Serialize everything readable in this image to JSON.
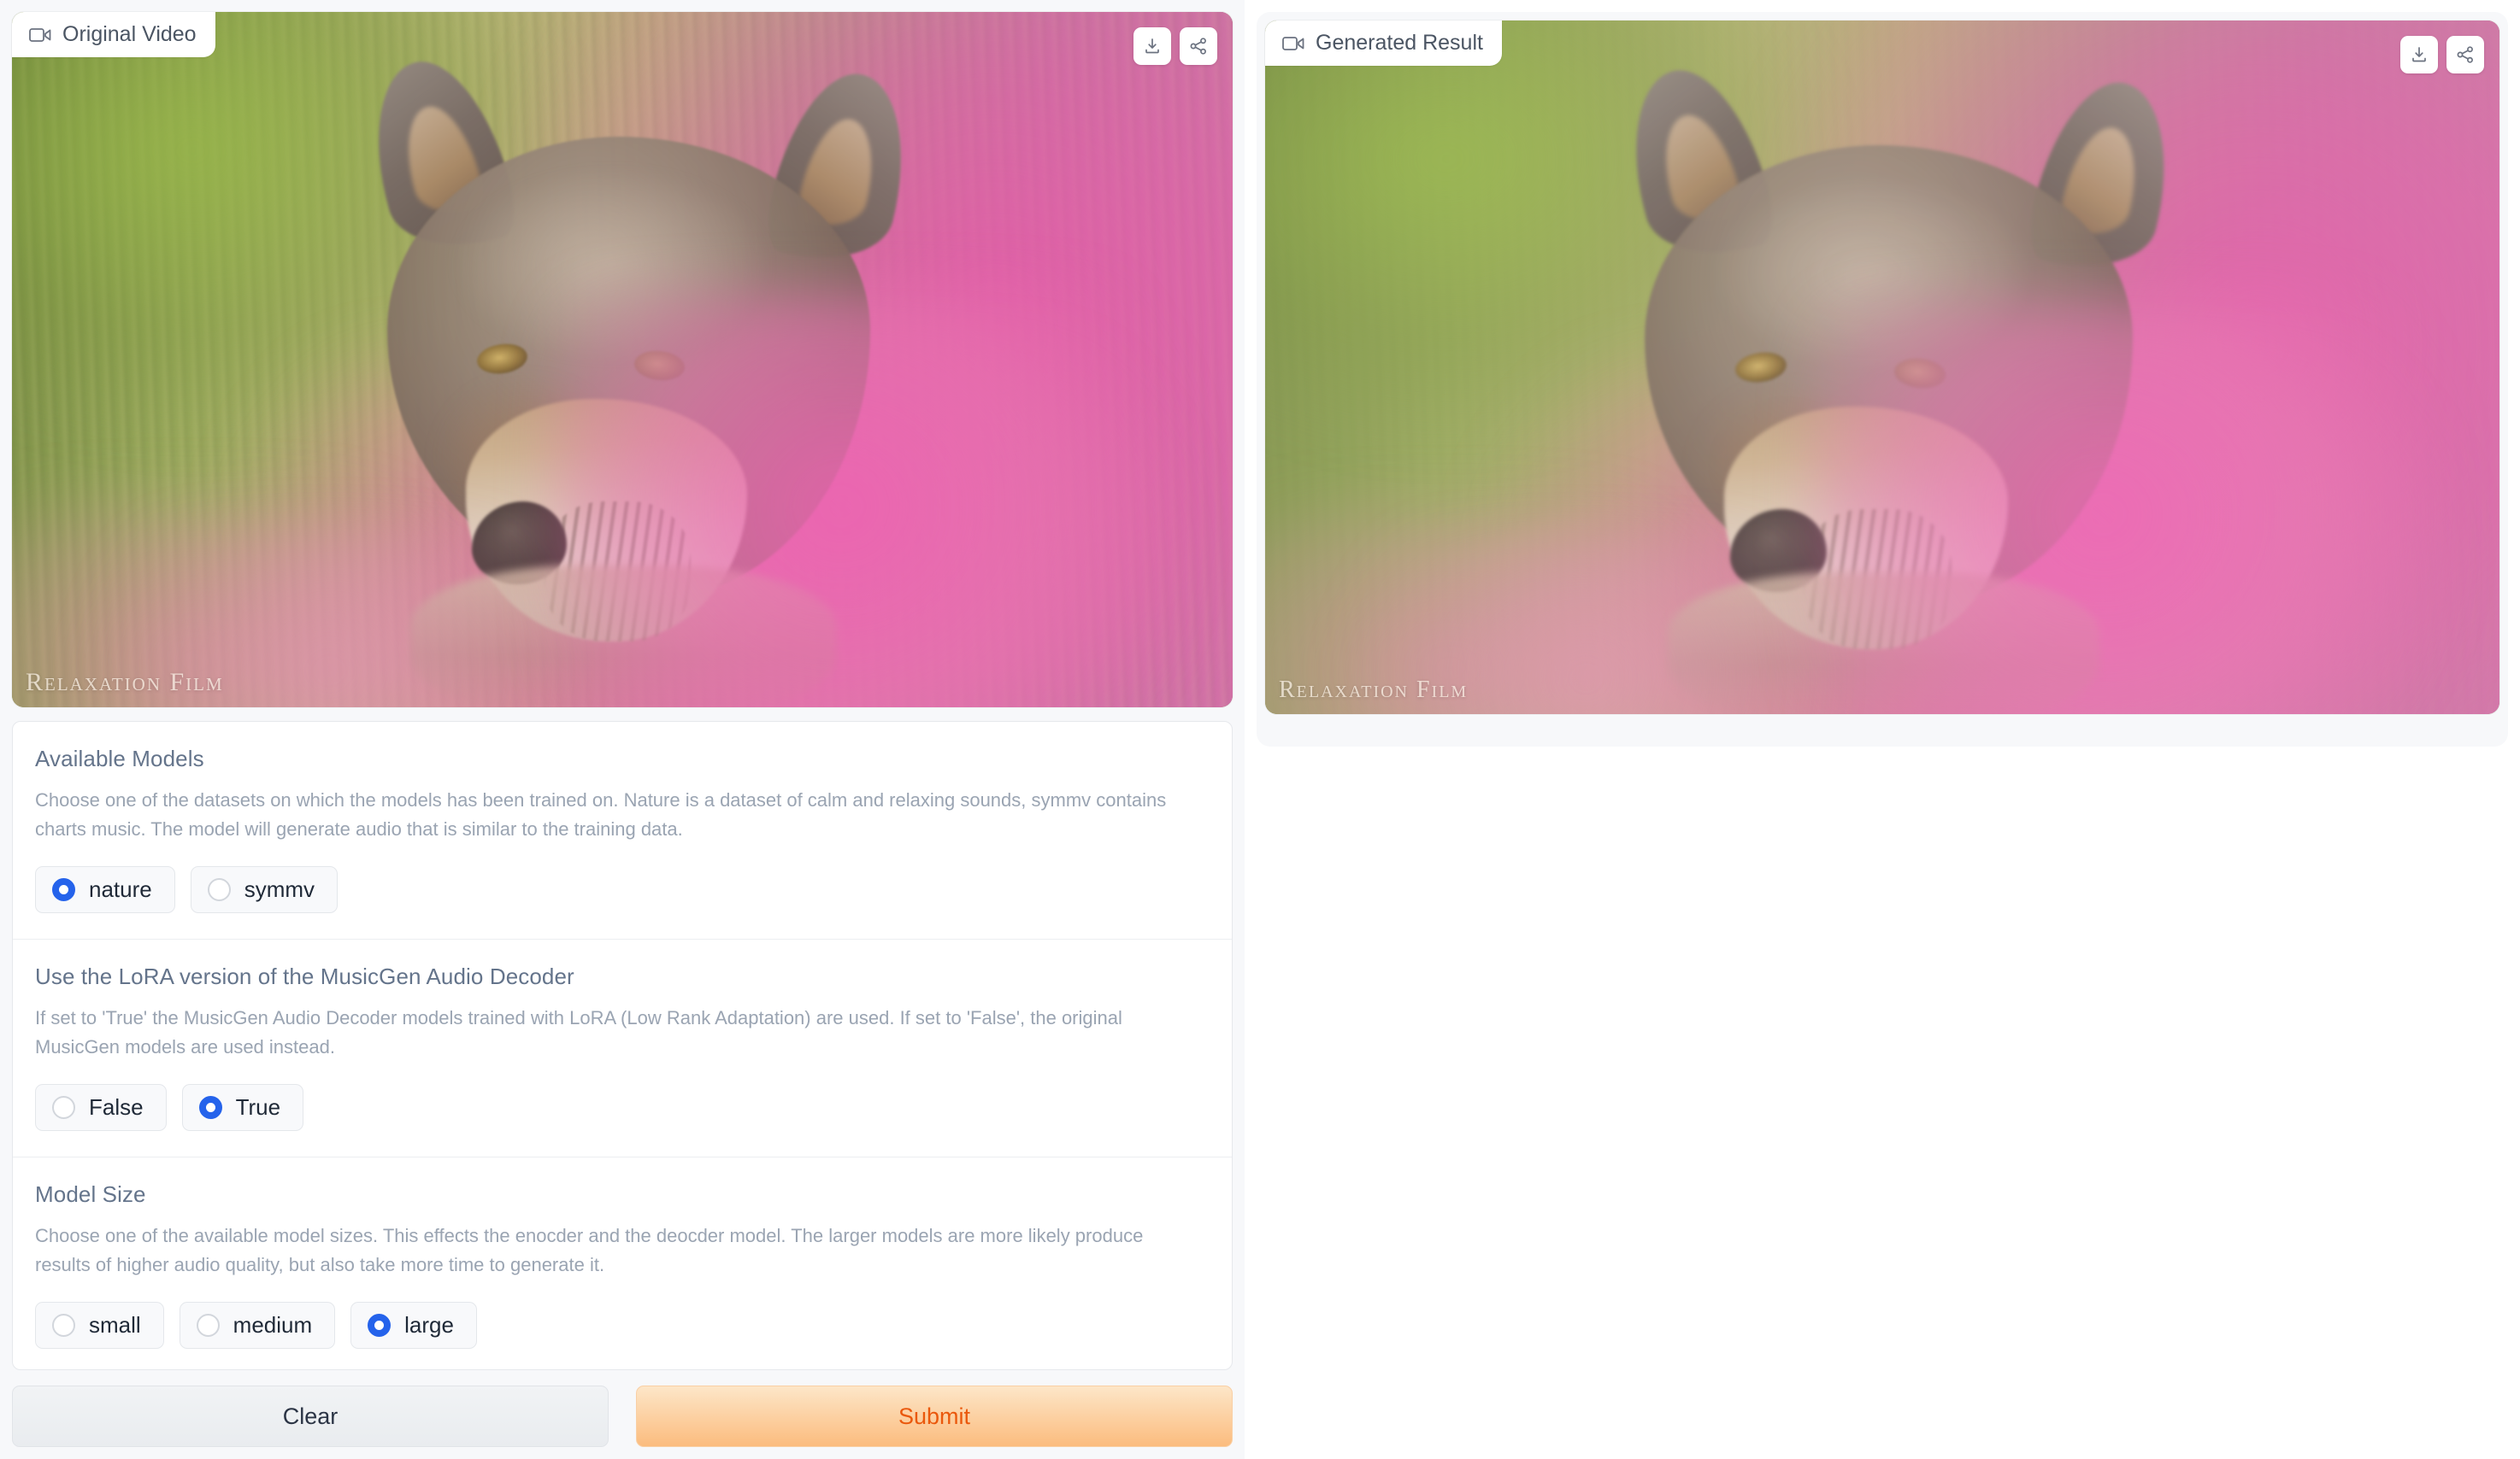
{
  "left_panel": {
    "video": {
      "chip_label": "Original Video",
      "chip_icon": "video-camera-icon",
      "watermark": "Relaxation Film",
      "actions": [
        {
          "name": "download-button",
          "icon": "download-icon"
        },
        {
          "name": "share-button",
          "icon": "share-icon"
        }
      ]
    },
    "form": {
      "sections": [
        {
          "id": "available-models",
          "title": "Available Models",
          "description": "Choose one of the datasets on which the models has been trained on. Nature is a dataset of calm and relaxing sounds, symmv contains charts music. The model will generate audio that is similar to the training data.",
          "options": [
            {
              "label": "nature",
              "checked": true
            },
            {
              "label": "symmv",
              "checked": false
            }
          ]
        },
        {
          "id": "lora-decoder",
          "title": "Use the LoRA version of the MusicGen Audio Decoder",
          "description": "If set to 'True' the MusicGen Audio Decoder models trained with LoRA (Low Rank Adaptation) are used. If set to 'False', the original MusicGen models are used instead.",
          "options": [
            {
              "label": "False",
              "checked": false
            },
            {
              "label": "True",
              "checked": true
            }
          ]
        },
        {
          "id": "model-size",
          "title": "Model Size",
          "description": "Choose one of the available model sizes. This effects the enocder and the deocder model. The larger models are more likely produce results of higher audio quality, but also take more time to generate it.",
          "options": [
            {
              "label": "small",
              "checked": false
            },
            {
              "label": "medium",
              "checked": false
            },
            {
              "label": "large",
              "checked": true
            }
          ]
        }
      ]
    },
    "buttons": {
      "clear": "Clear",
      "submit": "Submit"
    }
  },
  "right_panel": {
    "video": {
      "chip_label": "Generated Result",
      "chip_icon": "video-camera-icon",
      "watermark": "Relaxation Film",
      "actions": [
        {
          "name": "download-button",
          "icon": "download-icon"
        },
        {
          "name": "share-button",
          "icon": "share-icon"
        }
      ]
    }
  },
  "colors": {
    "accent_radio": "#2563eb",
    "submit_text": "#ea580c",
    "submit_bg_top": "#fde6c8",
    "submit_bg_bottom": "#fbbc7e",
    "clear_bg": "#eceff1",
    "label_text": "#64748b",
    "desc_text": "#9aa4b2",
    "page_bg": "#f7f8fa"
  }
}
